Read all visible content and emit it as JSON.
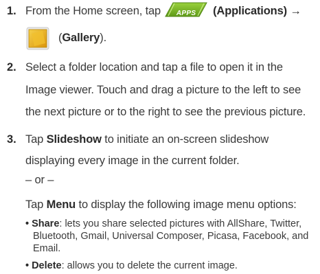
{
  "steps": [
    {
      "number": "1.",
      "line1_prefix": "From the Home screen, tap",
      "apps_label": "APPS",
      "applications": "(Applications)",
      "applications_arrow": "→",
      "gallery": "(Gallery).",
      "gallery_paren_open": "(",
      "gallery_bold": "Gallery",
      "gallery_paren_close": ")."
    },
    {
      "number": "2.",
      "lines": [
        "Select a folder location and tap a file to open it in the",
        "Image viewer. Touch and drag a picture to the left to see",
        "the next picture or to the right to see the previous picture."
      ]
    },
    {
      "number": "3.",
      "line1_bold": "Slideshow",
      "line1_prefix": "Tap",
      "line1_suffix": "to initiate an on-screen slideshow",
      "line2": "displaying every image in the current folder.",
      "or": "– or –",
      "menu_prefix": "Tap",
      "menu_bold": "Menu",
      "menu_suffix": "to display the following image menu options:"
    }
  ],
  "bullets": [
    {
      "term": "Share",
      "lines": [
        ": lets you share selected pictures with AllShare, Twitter,",
        "Bluetooth, Gmail, Universal Composer, Picasa, Facebook, and",
        "Email."
      ]
    },
    {
      "term": "Delete",
      "lines": [
        ": allows you to delete the current image."
      ]
    }
  ],
  "icons": {
    "apps": "apps-button-icon",
    "gallery": "gallery-icon",
    "apps_color": "#77b82a",
    "gallery_color": "#e8b21e"
  }
}
